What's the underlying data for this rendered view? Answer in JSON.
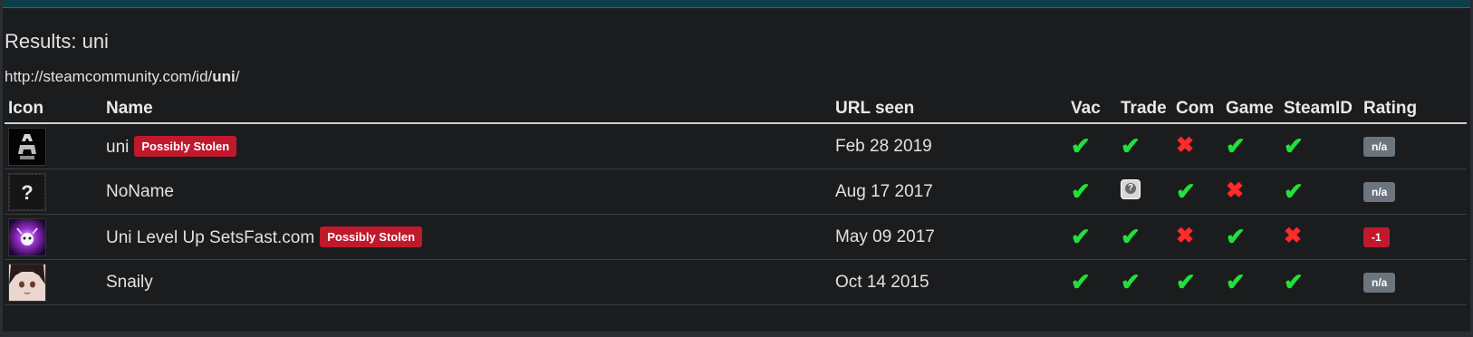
{
  "results_title": "Results: uni",
  "url": {
    "prefix": "http://steamcommunity.com/id/",
    "bold": "uni",
    "suffix": "/"
  },
  "columns": [
    "Icon",
    "Name",
    "URL seen",
    "Vac",
    "Trade",
    "Com",
    "Game",
    "SteamID",
    "Rating"
  ],
  "rows": [
    {
      "name": "uni",
      "badge": "Possibly Stolen",
      "seen": "Feb 28 2019",
      "checks": {
        "vac": "check",
        "trade": "check",
        "com": "cross",
        "game": "check",
        "steamid": "check"
      },
      "rating": "n/a",
      "avatar": "dark-figure-avatar"
    },
    {
      "name": "NoName",
      "badge": "",
      "seen": "Aug 17 2017",
      "checks": {
        "vac": "check",
        "trade": "unknown",
        "com": "check",
        "game": "cross",
        "steamid": "check"
      },
      "rating": "n/a",
      "avatar": "question-mark-avatar"
    },
    {
      "name": "Uni Level Up SetsFast.com",
      "badge": "Possibly Stolen",
      "seen": "May 09 2017",
      "checks": {
        "vac": "check",
        "trade": "check",
        "com": "cross",
        "game": "check",
        "steamid": "cross"
      },
      "rating": "-1",
      "avatar": "purple-glow-avatar"
    },
    {
      "name": "Snaily",
      "badge": "",
      "seen": "Oct 14 2015",
      "checks": {
        "vac": "check",
        "trade": "check",
        "com": "check",
        "game": "check",
        "steamid": "check"
      },
      "rating": "n/a",
      "avatar": "anime-face-avatar"
    }
  ],
  "colors": {
    "check": "#22e03a",
    "cross": "#ff2a2a",
    "badge": "#c0192b",
    "rating_na": "#6c757d",
    "rating_neg": "#c0192b",
    "topbar": "#0b3f49"
  }
}
